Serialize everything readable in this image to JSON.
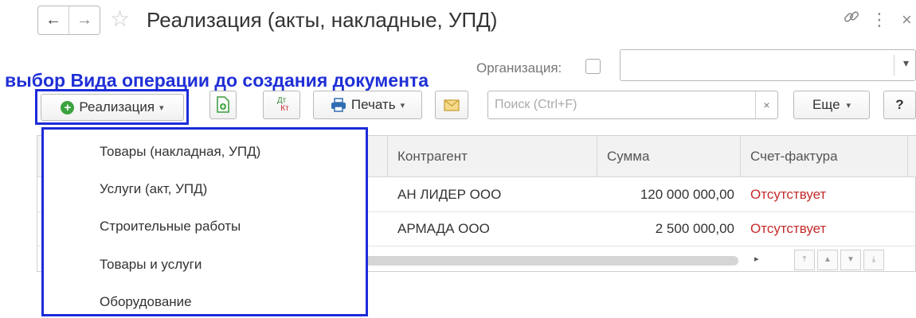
{
  "header": {
    "title": "Реализация (акты, накладные, УПД)",
    "back_icon": "←",
    "forward_icon": "→",
    "star_icon": "☆",
    "link_icon": "🔗",
    "more_icon": "⋮",
    "close_icon": "×"
  },
  "annotation": "выбор Вида операции до создания документа",
  "organization": {
    "label": "Организация:",
    "checked": false,
    "value": ""
  },
  "toolbar": {
    "create_label": "Реализация",
    "print_label": "Печать",
    "search_placeholder": "Поиск (Ctrl+F)",
    "clear_icon": "×",
    "more_label": "Еще",
    "help_label": "?",
    "dtkt_top": "Дт",
    "dtkt_bottom": "Кт"
  },
  "dropdown": {
    "items": [
      {
        "label": "Товары (накладная, УПД)"
      },
      {
        "label": "Услуги (акт, УПД)"
      },
      {
        "label": "Строительные работы"
      },
      {
        "label": "Товары и услуги"
      },
      {
        "label": "Оборудование"
      }
    ]
  },
  "table": {
    "columns": [
      "Контрагент",
      "Сумма",
      "Счет-фактура"
    ],
    "rows": [
      {
        "contractor": "АН ЛИДЕР ООО",
        "sum": "120 000 000,00",
        "invoice": "Отсутствует"
      },
      {
        "contractor": "АРМАДА ООО",
        "sum": "2 500 000,00",
        "invoice": "Отсутствует"
      }
    ]
  },
  "colors": {
    "annotation": "#1f2fd6",
    "highlight_frame": "#1c2bd9",
    "missing_invoice": "#c62b2b",
    "create_icon": "#3aa33f"
  }
}
